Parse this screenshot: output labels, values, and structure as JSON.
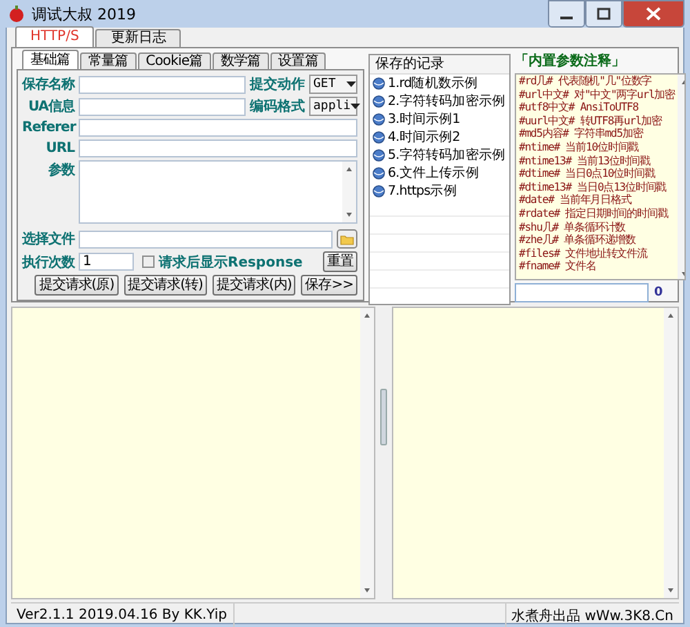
{
  "window": {
    "title": "调试大叔 2019"
  },
  "main_tabs": [
    {
      "label": "HTTP/S",
      "selected": true
    },
    {
      "label": "更新日志",
      "selected": false
    }
  ],
  "sub_tabs": [
    {
      "label": "基础篇",
      "selected": true
    },
    {
      "label": "常量篇",
      "selected": false
    },
    {
      "label": "Cookie篇",
      "selected": false
    },
    {
      "label": "数学篇",
      "selected": false
    },
    {
      "label": "设置篇",
      "selected": false
    }
  ],
  "form": {
    "save_name": {
      "label": "保存名称"
    },
    "action": {
      "label": "提交动作",
      "value": "GET"
    },
    "ua": {
      "label": "UA信息"
    },
    "encoding": {
      "label": "编码格式",
      "value": "appli"
    },
    "referer": {
      "label": "Referer"
    },
    "url": {
      "label": "URL"
    },
    "params": {
      "label": "参数"
    },
    "file": {
      "label": "选择文件"
    },
    "count": {
      "label": "执行次数",
      "value": "1"
    },
    "show_response": {
      "label": "请求后显示Response",
      "checked": false
    },
    "reset_button": "重置",
    "buttons": [
      "提交请求(原)",
      "提交请求(转)",
      "提交请求(内)",
      "保存>>"
    ]
  },
  "records": {
    "title": "保存的记录",
    "items": [
      "1.rd随机数示例",
      "2.字符转码加密示例",
      "3.时间示例1",
      "4.时间示例2",
      "5.字符转码加密示例",
      "6.文件上传示例",
      "7.https示例"
    ]
  },
  "notes": {
    "title": "「内置参数注释」",
    "count": "0",
    "lines": [
      {
        "param": "#rd几#",
        "desc": "代表随机\"几\"位数字"
      },
      {
        "param": "#url中文#",
        "desc": "对\"中文\"两字url加密"
      },
      {
        "param": "#utf8中文#",
        "desc": "AnsiToUTF8"
      },
      {
        "param": "#uurl中文#",
        "desc": "转UTF8再url加密"
      },
      {
        "param": "#md5内容#",
        "desc": "字符串md5加密"
      },
      {
        "param": "#ntime#",
        "desc": "当前10位时间戳"
      },
      {
        "param": "#ntime13#",
        "desc": "当前13位时间戳"
      },
      {
        "param": "#dtime#",
        "desc": "当日0点10位时间戳"
      },
      {
        "param": "#dtime13#",
        "desc": "当日0点13位时间戳"
      },
      {
        "param": "#date#",
        "desc": "当前年月日格式"
      },
      {
        "param": "#rdate#",
        "desc": "指定日期时间的时间戳"
      },
      {
        "param": "#shu几#",
        "desc": "单条循环计数"
      },
      {
        "param": "#zhe几#",
        "desc": "单条循环递增数"
      },
      {
        "param": "#files#",
        "desc": "文件地址转文件流"
      },
      {
        "param": "#fname#",
        "desc": "文件名"
      }
    ]
  },
  "status_bar": {
    "left": "Ver2.1.1 2019.04.16 By KK.Yip",
    "right": "水煮舟出品 wWw.3K8.Cn"
  }
}
